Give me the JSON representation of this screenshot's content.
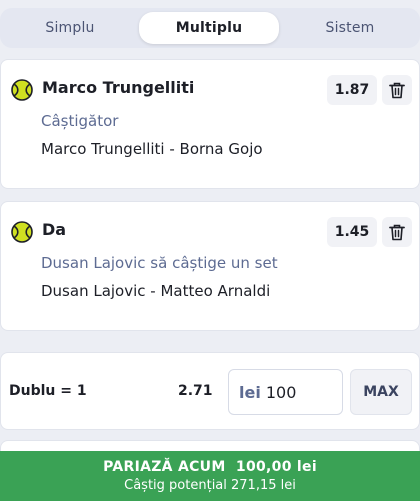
{
  "tabs": [
    {
      "label": "Simplu"
    },
    {
      "label": "Multiplu"
    },
    {
      "label": "Sistem"
    }
  ],
  "active_tab": "Multiplu",
  "bets": [
    {
      "selection": "Marco Trungelliti",
      "market": "Câștigător",
      "event": "Marco Trungelliti - Borna Gojo",
      "odds": "1.87",
      "sport_icon": "tennis-ball-icon"
    },
    {
      "selection": "Da",
      "market": "Dusan Lajovic să câștige un set",
      "event": "Dusan Lajovic - Matteo Arnaldi",
      "odds": "1.45",
      "sport_icon": "tennis-ball-icon"
    }
  ],
  "stake": {
    "combo_label": "Dublu = 1",
    "combo_odds": "2.71",
    "currency": "lei",
    "amount": "100",
    "max_label": "MAX"
  },
  "place_bet": {
    "label": "PARIAZĂ ACUM  100,00 lei",
    "potential": "Câștig potențial 271,15 lei"
  },
  "colors": {
    "accent_green": "#3aa255",
    "ball_yellow": "#cfe021",
    "market_text": "#5d6b92"
  }
}
